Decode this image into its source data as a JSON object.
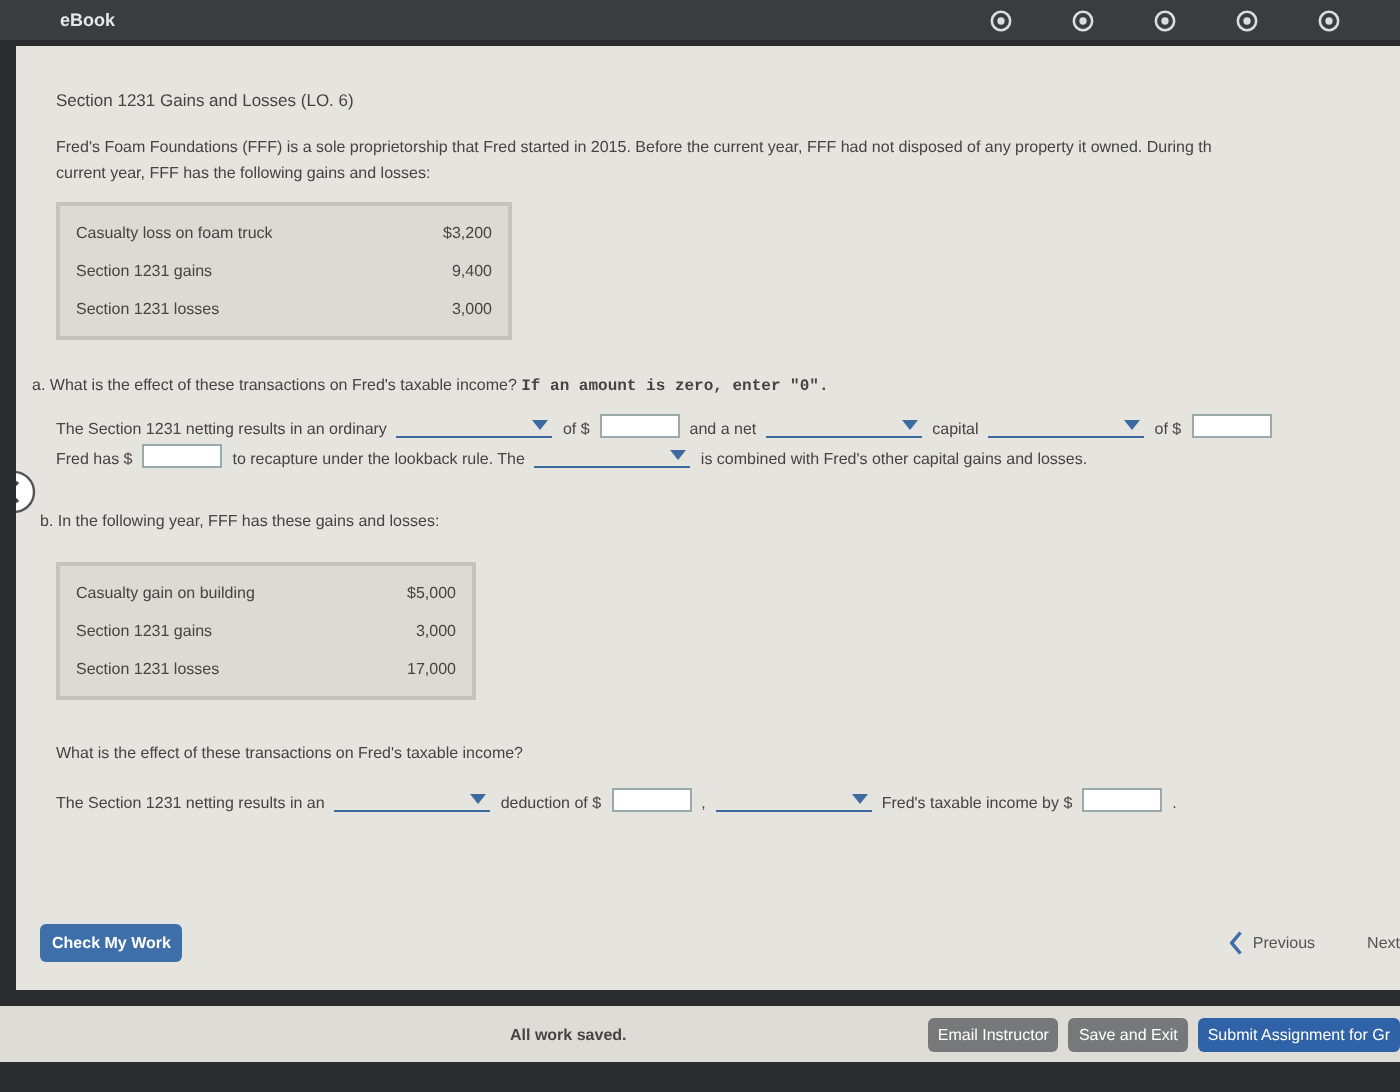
{
  "topbar": {
    "title": "eBook"
  },
  "heading": "Section 1231 Gains and Losses (LO. 6)",
  "intro_lines": [
    "Fred's Foam Foundations (FFF) is a sole proprietorship that Fred started in 2015. Before the current year, FFF had not disposed of any property it owned. During th",
    "current year, FFF has the following gains and losses:"
  ],
  "table_a": [
    {
      "label": "Casualty loss on foam truck",
      "amount": "$3,200"
    },
    {
      "label": "Section 1231 gains",
      "amount": "9,400"
    },
    {
      "label": "Section 1231 losses",
      "amount": "3,000"
    }
  ],
  "question_a": {
    "prompt": "a. What is the effect of these transactions on Fred's taxable income? **If an amount is zero, enter \"0\".**",
    "lines": [
      [
        {
          "kind": "text",
          "text": "The Section 1231 netting results in an ordinary"
        },
        {
          "kind": "dropdown"
        },
        {
          "kind": "text",
          "text": "of $"
        },
        {
          "kind": "amount"
        },
        {
          "kind": "text",
          "text": "and a net"
        },
        {
          "kind": "dropdown"
        },
        {
          "kind": "text",
          "text": "capital"
        },
        {
          "kind": "dropdown"
        },
        {
          "kind": "text",
          "text": "of $"
        },
        {
          "kind": "amount"
        }
      ],
      [
        {
          "kind": "text",
          "text": "Fred has $"
        },
        {
          "kind": "amount"
        },
        {
          "kind": "text",
          "text": "to recapture under the lookback rule. The"
        },
        {
          "kind": "dropdown"
        },
        {
          "kind": "text",
          "text": "is combined with Fred's other capital gains and losses."
        }
      ]
    ]
  },
  "question_b": {
    "prompt": "b. In the following year, FFF has these gains and losses:",
    "table": [
      {
        "label": "Casualty gain on building",
        "amount": "$5,000"
      },
      {
        "label": "Section 1231 gains",
        "amount": "3,000"
      },
      {
        "label": "Section 1231 losses",
        "amount": "17,000"
      }
    ],
    "question": "What is the effect of these transactions on Fred's taxable income?",
    "lines": [
      [
        {
          "kind": "text",
          "text": "The Section 1231 netting results in an"
        },
        {
          "kind": "dropdown"
        },
        {
          "kind": "text",
          "text": "deduction of $"
        },
        {
          "kind": "amount"
        },
        {
          "kind": "text",
          "text": ","
        },
        {
          "kind": "dropdown"
        },
        {
          "kind": "text",
          "text": "Fred's taxable income by $"
        },
        {
          "kind": "amount"
        },
        {
          "kind": "text",
          "text": "."
        }
      ]
    ]
  },
  "nav": {
    "check": "Check My Work",
    "previous": "Previous",
    "next": "Next"
  },
  "footer": {
    "status": "All work saved.",
    "buttons": [
      {
        "label": "Email Instructor",
        "kind": "secondary"
      },
      {
        "label": "Save and Exit",
        "kind": "secondary"
      },
      {
        "label": "Submit Assignment for Gr",
        "kind": "primary"
      }
    ]
  }
}
